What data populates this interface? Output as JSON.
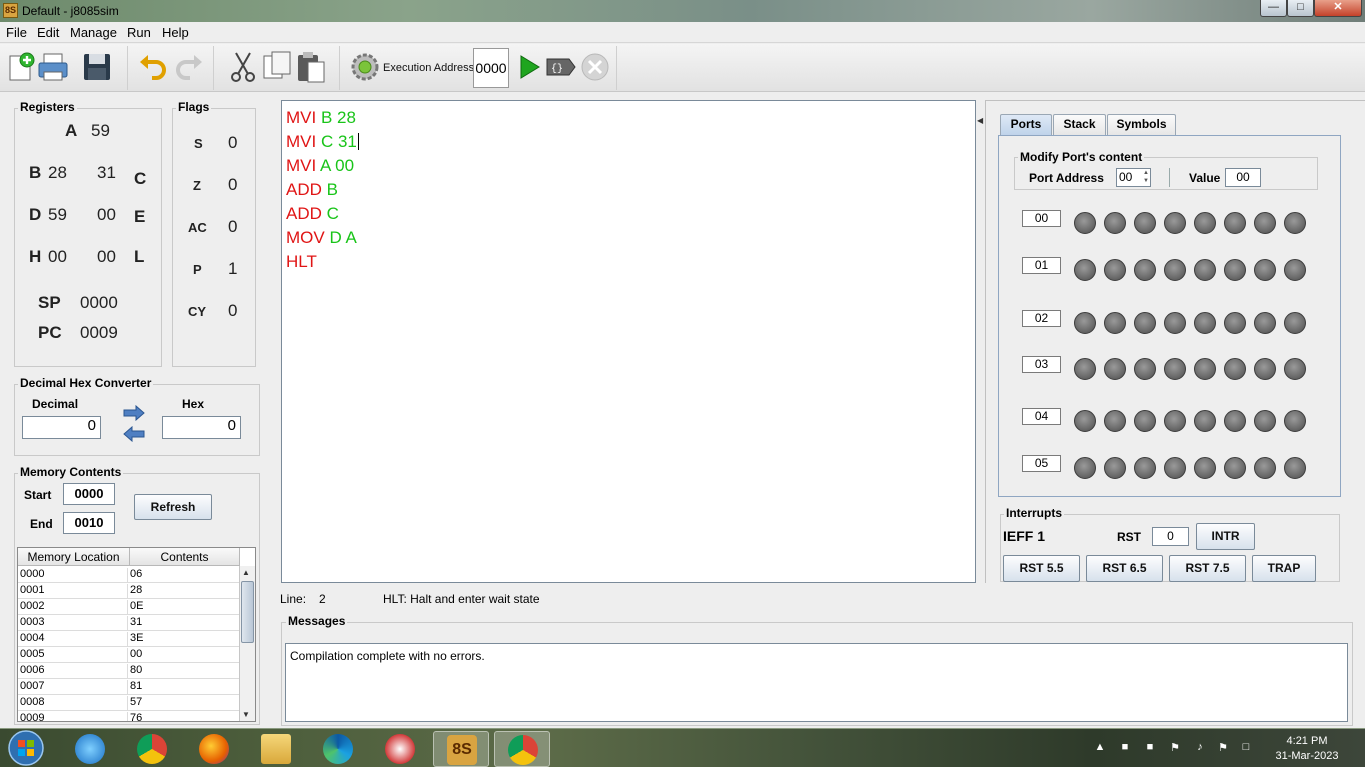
{
  "window": {
    "title": "Default - j8085sim"
  },
  "menu": [
    {
      "label": "File"
    },
    {
      "label": "Edit"
    },
    {
      "label": "Manage"
    },
    {
      "label": "Run"
    },
    {
      "label": "Help"
    }
  ],
  "toolbar": {
    "execution_label": "Execution Address:",
    "execution_address": "0000"
  },
  "registers": {
    "legend": "Registers",
    "A": {
      "name": "A",
      "value": "59"
    },
    "B": {
      "name": "B",
      "value": "28"
    },
    "C": {
      "name": "C",
      "value": "31"
    },
    "D": {
      "name": "D",
      "value": "59"
    },
    "E": {
      "name": "E",
      "value": "00"
    },
    "H": {
      "name": "H",
      "value": "00"
    },
    "L": {
      "name": "L",
      "value": "00"
    },
    "SP": {
      "name": "SP",
      "value": "0000"
    },
    "PC": {
      "name": "PC",
      "value": "0009"
    }
  },
  "flags": {
    "legend": "Flags",
    "items": [
      {
        "name": "S",
        "value": "0"
      },
      {
        "name": "Z",
        "value": "0"
      },
      {
        "name": "AC",
        "value": "0"
      },
      {
        "name": "P",
        "value": "1"
      },
      {
        "name": "CY",
        "value": "0"
      }
    ]
  },
  "converter": {
    "legend": "Decimal Hex Converter",
    "decimal_label": "Decimal",
    "hex_label": "Hex",
    "decimal_value": "0",
    "hex_value": "0"
  },
  "memory": {
    "legend": "Memory Contents",
    "start_label": "Start",
    "start_value": "0000",
    "end_label": "End",
    "end_value": "0010",
    "refresh_label": "Refresh",
    "columns": [
      "Memory Location",
      "Contents"
    ],
    "rows": [
      [
        "0000",
        "06"
      ],
      [
        "0001",
        "28"
      ],
      [
        "0002",
        "0E"
      ],
      [
        "0003",
        "31"
      ],
      [
        "0004",
        "3E"
      ],
      [
        "0005",
        "00"
      ],
      [
        "0006",
        "80"
      ],
      [
        "0007",
        "81"
      ],
      [
        "0008",
        "57"
      ],
      [
        "0009",
        "76"
      ]
    ]
  },
  "editor": {
    "lines": [
      {
        "op": "MVI",
        "arg": "B 28"
      },
      {
        "op": "MVI",
        "arg": "C 31"
      },
      {
        "op": "MVI",
        "arg": "A 00"
      },
      {
        "op": "ADD",
        "arg": "B"
      },
      {
        "op": "ADD",
        "arg": "C"
      },
      {
        "op": "MOV",
        "arg": "D A"
      },
      {
        "op": "HLT",
        "arg": ""
      }
    ]
  },
  "status": {
    "line_label": "Line:",
    "line_value": "2",
    "hint": "HLT: Halt and enter wait state"
  },
  "messages": {
    "legend": "Messages",
    "text": "Compilation complete with no errors."
  },
  "tabs": [
    {
      "label": "Ports"
    },
    {
      "label": "Stack"
    },
    {
      "label": "Symbols"
    }
  ],
  "ports": {
    "modify_legend": "Modify Port's content",
    "address_label": "Port Address",
    "address_value": "00",
    "value_label": "Value",
    "value_value": "00",
    "rows": [
      "00",
      "01",
      "02",
      "03",
      "04",
      "05"
    ]
  },
  "interrupts": {
    "legend": "Interrupts",
    "ieff": "IEFF 1",
    "rst_label": "RST",
    "rst_value": "0",
    "intr": "INTR",
    "buttons": [
      "RST 5.5",
      "RST 6.5",
      "RST 7.5",
      "TRAP"
    ]
  },
  "taskbar": {
    "time": "4:21 PM",
    "date": "31-Mar-2023"
  },
  "colors": {
    "opcode": "#e01515",
    "operand": "#19c419",
    "accent": "#8fa6c2"
  }
}
